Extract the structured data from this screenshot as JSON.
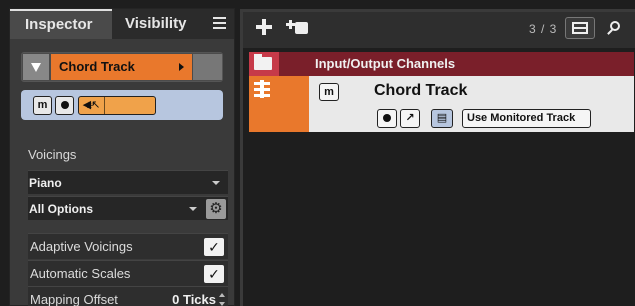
{
  "inspector": {
    "tabs": [
      {
        "label": "Inspector",
        "active": true
      },
      {
        "label": "Visibility",
        "active": false
      }
    ],
    "track_header": {
      "name": "Chord Track",
      "color": "#e9782c"
    },
    "controls": {
      "mute_label": "m",
      "accent_color": "#f0a24a"
    },
    "voicings_section": {
      "label": "Voicings",
      "voicing_value": "Piano",
      "options_value": "All Options"
    },
    "options": [
      {
        "label": "Adaptive Voicings",
        "checked": true
      },
      {
        "label": "Automatic Scales",
        "checked": true
      }
    ],
    "mapping_offset": {
      "label": "Mapping Offset",
      "value": "0 Ticks"
    }
  },
  "tracklist": {
    "count": "3 / 3",
    "folder": {
      "name": "Input/Output Channels",
      "color": "#7a1f2a"
    },
    "chord_track": {
      "name": "Chord Track",
      "mute_label": "m",
      "monitor_label": "Use Monitored Track",
      "color": "#e9782c"
    }
  }
}
